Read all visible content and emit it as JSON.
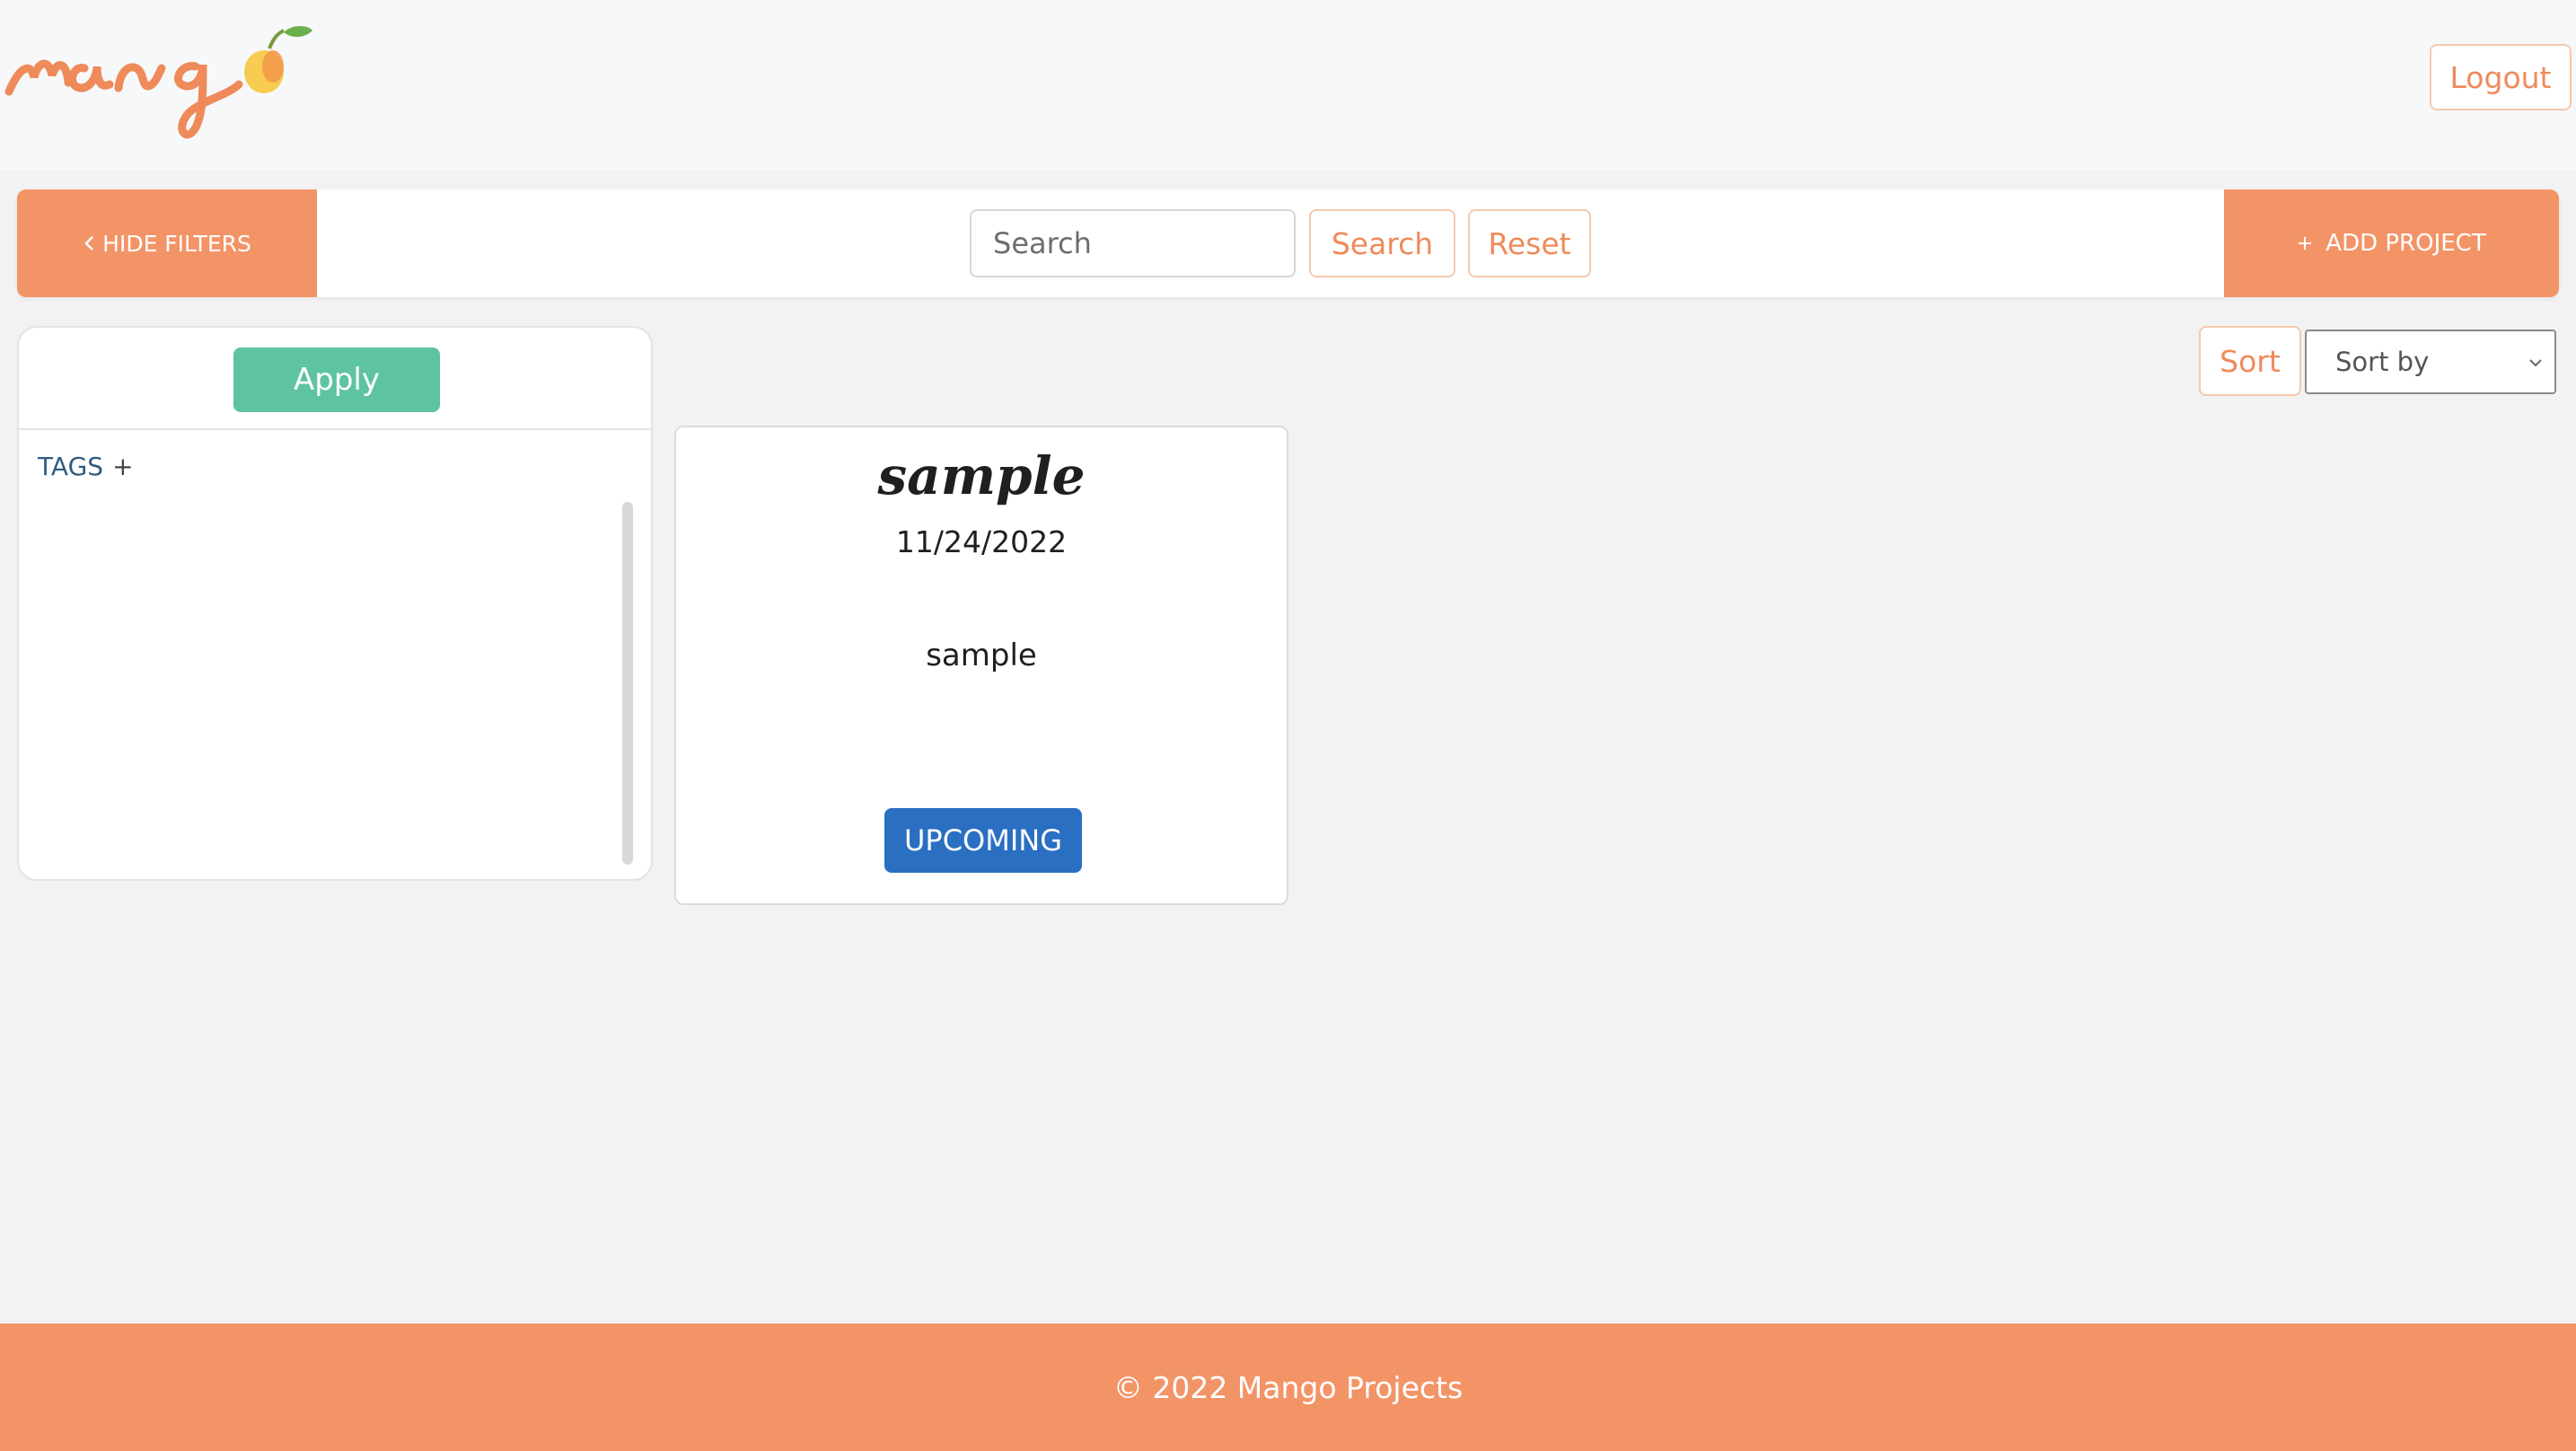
{
  "header": {
    "logo_text": "mango",
    "logout_label": "Logout"
  },
  "toolbar": {
    "hide_filters_label": "HIDE FILTERS",
    "search_placeholder": "Search",
    "search_label": "Search",
    "reset_label": "Reset",
    "add_project_label": "ADD PROJECT"
  },
  "filters": {
    "apply_label": "Apply",
    "tags_label": "TAGS",
    "tags_add": "+"
  },
  "sort": {
    "sort_label": "Sort",
    "select_value": "Sort by"
  },
  "projects": [
    {
      "title": "sample",
      "date": "11/24/2022",
      "description": "sample",
      "status": "UPCOMING"
    }
  ],
  "footer": {
    "copyright": "© 2022 Mango Projects"
  },
  "colors": {
    "accent": "#f39467",
    "accent_text": "#ef8a5a",
    "apply_green": "#5ec3a0",
    "status_blue": "#2a6fc2",
    "tags_blue": "#2e5c82"
  },
  "icons": {
    "hide_filters": "chevron-left-icon",
    "add_project": "plus-icon",
    "sort_select": "chevron-down-icon"
  }
}
